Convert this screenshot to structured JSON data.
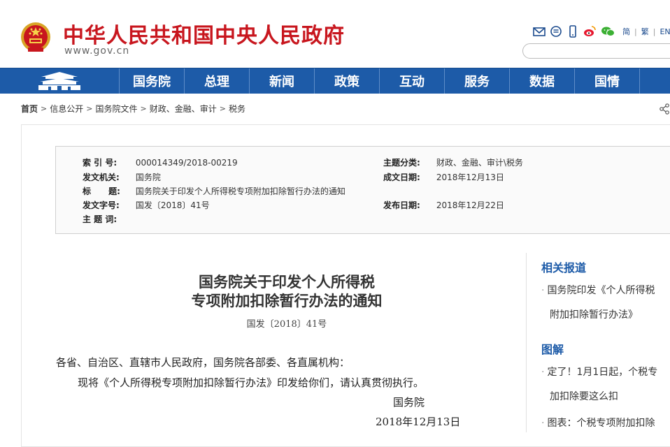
{
  "header": {
    "title": "中华人民共和国中央人民政府",
    "url": "www.gov.cn",
    "lang_simplified": "简",
    "lang_traditional": "繁",
    "lang_english": "EN",
    "separator": "|"
  },
  "nav": {
    "items": [
      {
        "label": "国务院"
      },
      {
        "label": "总理"
      },
      {
        "label": "新闻"
      },
      {
        "label": "政策"
      },
      {
        "label": "互动"
      },
      {
        "label": "服务"
      },
      {
        "label": "数据"
      },
      {
        "label": "国情"
      }
    ]
  },
  "breadcrumb": {
    "items": [
      "首页",
      "信息公开",
      "国务院文件",
      "财政、金融、审计",
      "税务"
    ]
  },
  "meta": {
    "index_label": "索 引 号:",
    "index_value": "000014349/2018-00219",
    "category_label": "主题分类:",
    "category_value": "财政、金融、审计\\税务",
    "issuer_label": "发文机关:",
    "issuer_value": "国务院",
    "written_label": "成文日期:",
    "written_value": "2018年12月13日",
    "subject_label": "标      题:",
    "subject_value": "国务院关于印发个人所得税专项附加扣除暂行办法的通知",
    "docno_label": "发文字号:",
    "docno_value": "国发〔2018〕41号",
    "published_label": "发布日期:",
    "published_value": "2018年12月22日",
    "keywords_label": "主 题 词:",
    "keywords_value": ""
  },
  "article": {
    "title_line1": "国务院关于印发个人所得税",
    "title_line2": "专项附加扣除暂行办法的通知",
    "doc_number": "国发〔2018〕41号",
    "salutation": "各省、自治区、直辖市人民政府，国务院各部委、各直属机构：",
    "paragraph1": "现将《个人所得税专项附加扣除暂行办法》印发给你们，请认真贯彻执行。",
    "signature": "国务院",
    "date": "2018年12月13日"
  },
  "sidebar": {
    "related_heading": "相关报道",
    "related_link_line1": "国务院印发《个人所得税",
    "related_link_line2": "附加扣除暂行办法》",
    "graphic_heading": "图解",
    "graphic_link1_line1": "定了！1月1日起，个税专",
    "graphic_link1_line2": "加扣除要这么扣",
    "graphic_link2_line1": "图表：个税专项附加扣除"
  },
  "colors": {
    "brand_red": "#c8161e",
    "nav_blue": "#1d5ba8",
    "link_blue": "#1d5ba8"
  },
  "icons": [
    "national-emblem-icon",
    "mail-icon",
    "chat-icon",
    "mobile-icon",
    "weibo-icon",
    "wechat-icon",
    "share-icon",
    "tiananmen-icon"
  ]
}
